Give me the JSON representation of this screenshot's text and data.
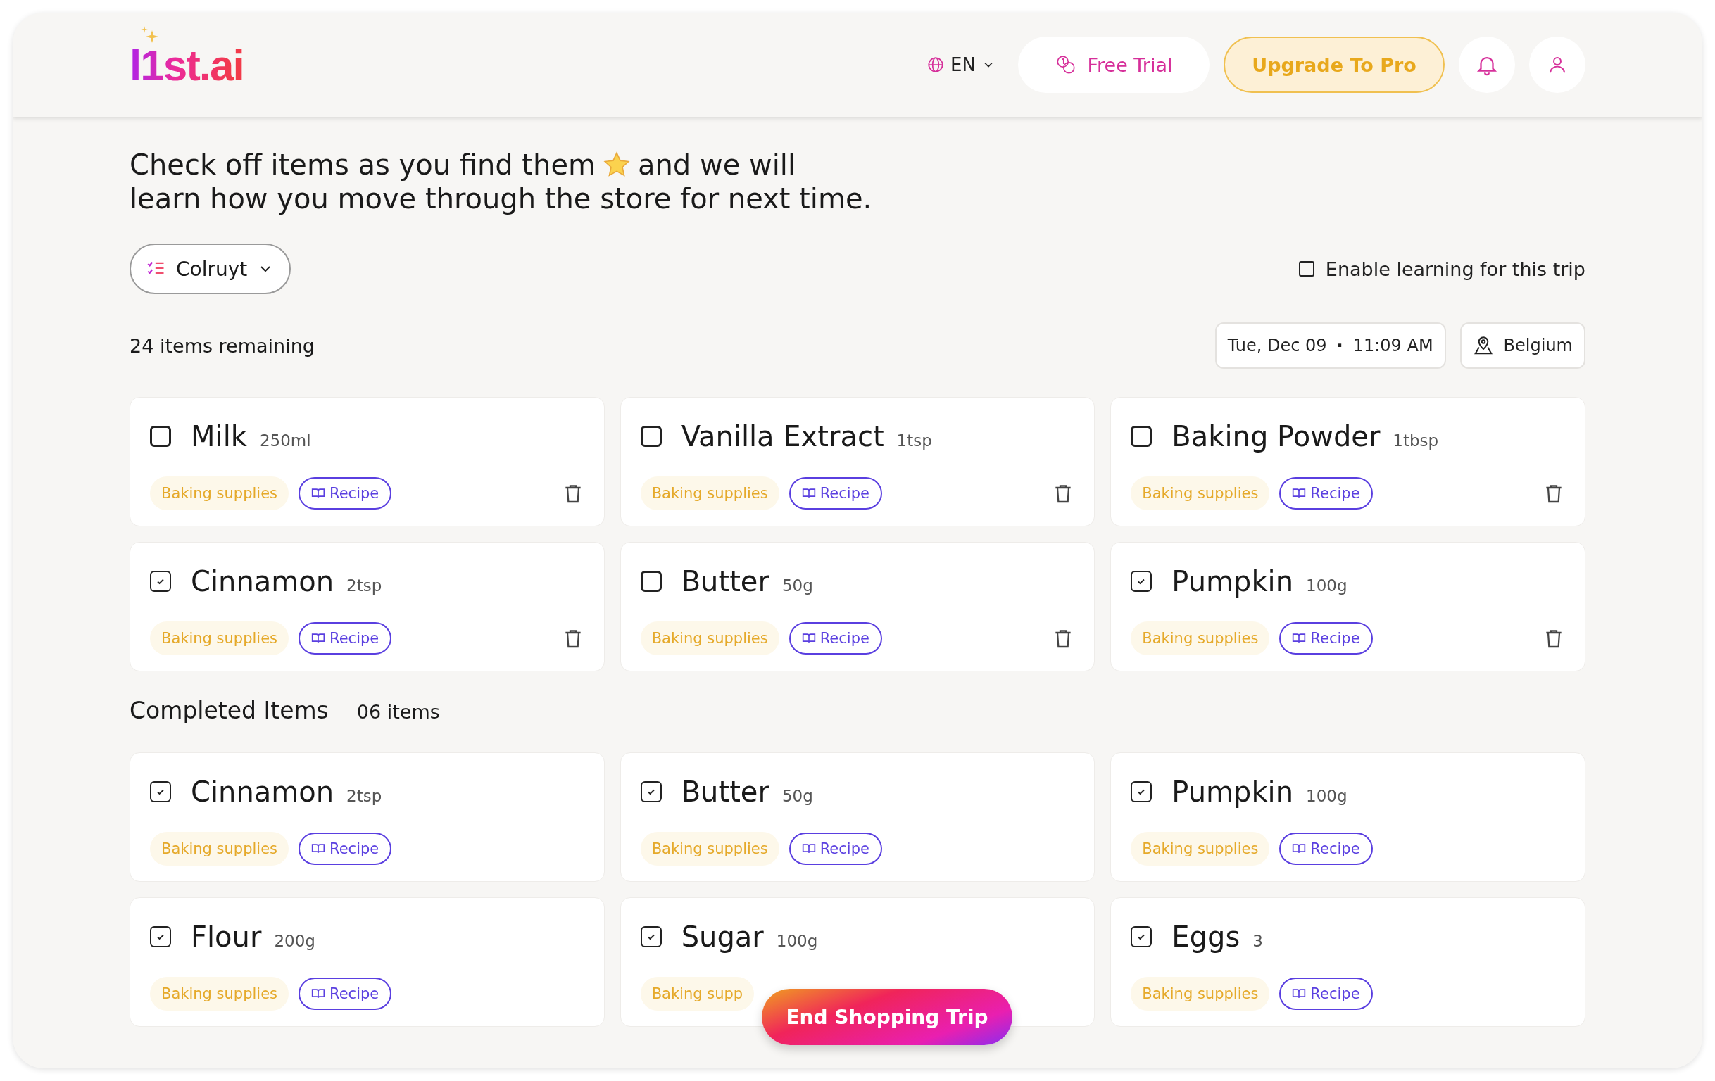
{
  "logo": {
    "text": "l1st.ai"
  },
  "header": {
    "language": "EN",
    "free_trial": "Free Trial",
    "upgrade": "Upgrade To Pro"
  },
  "intro": {
    "line1_start": "Check off items as you find them",
    "line1_end": "and we will",
    "line2": "learn how you move through the store for next time."
  },
  "store": {
    "label": "Colruyt"
  },
  "learning": {
    "label": "Enable learning for this trip",
    "checked": false
  },
  "remaining": "24 items remaining",
  "trip": {
    "date": "Tue, Dec 09",
    "separator": "·",
    "time": "11:09 AM",
    "location": "Belgium"
  },
  "items": [
    {
      "name": "Milk",
      "qty": "250ml",
      "checked": false,
      "tag": "Baking supplies",
      "recipe": "Recipe",
      "deletable": true
    },
    {
      "name": "Vanilla Extract",
      "qty": "1tsp",
      "checked": false,
      "tag": "Baking supplies",
      "recipe": "Recipe",
      "deletable": true
    },
    {
      "name": "Baking Powder",
      "qty": "1tbsp",
      "checked": false,
      "tag": "Baking supplies",
      "recipe": "Recipe",
      "deletable": true
    },
    {
      "name": "Cinnamon",
      "qty": "2tsp",
      "checked": true,
      "tag": "Baking supplies",
      "recipe": "Recipe",
      "deletable": true
    },
    {
      "name": "Butter",
      "qty": "50g",
      "checked": false,
      "tag": "Baking supplies",
      "recipe": "Recipe",
      "deletable": true
    },
    {
      "name": "Pumpkin",
      "qty": "100g",
      "checked": true,
      "tag": "Baking supplies",
      "recipe": "Recipe",
      "deletable": true
    }
  ],
  "completed": {
    "title": "Completed Items",
    "count": "06 items",
    "items": [
      {
        "name": "Cinnamon",
        "qty": "2tsp",
        "checked": true,
        "tag": "Baking supplies",
        "recipe": "Recipe",
        "deletable": false
      },
      {
        "name": "Butter",
        "qty": "50g",
        "checked": true,
        "tag": "Baking supplies",
        "recipe": "Recipe",
        "deletable": false
      },
      {
        "name": "Pumpkin",
        "qty": "100g",
        "checked": true,
        "tag": "Baking supplies",
        "recipe": "Recipe",
        "deletable": false
      },
      {
        "name": "Flour",
        "qty": "200g",
        "checked": true,
        "tag": "Baking supplies",
        "recipe": "Recipe",
        "deletable": false
      },
      {
        "name": "Sugar",
        "qty": "100g",
        "checked": true,
        "tag": "Baking supp",
        "deletable": false
      },
      {
        "name": "Eggs",
        "qty": "3",
        "checked": true,
        "tag": "Baking supplies",
        "recipe": "Recipe",
        "deletable": false
      }
    ]
  },
  "end_button": "End Shopping Trip"
}
